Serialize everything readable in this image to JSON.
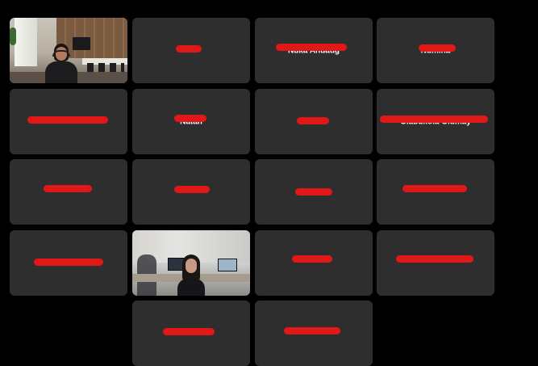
{
  "meeting": {
    "layout": "gallery-view",
    "tile_background": "#2e2e2e",
    "redaction_color": "#e01818"
  },
  "participants": [
    {
      "id": "p1",
      "display_name": "",
      "video_on": true,
      "scene": "office-woman-headset"
    },
    {
      "id": "p2",
      "display_name": "",
      "video_on": false
    },
    {
      "id": "p3",
      "display_name": "Nuka Anuaug",
      "video_on": false
    },
    {
      "id": "p4",
      "display_name": "Numina",
      "video_on": false
    },
    {
      "id": "p5",
      "display_name": "",
      "video_on": false
    },
    {
      "id": "p6",
      "display_name": "Natan",
      "video_on": false
    },
    {
      "id": "p7",
      "display_name": "",
      "video_on": false
    },
    {
      "id": "p8",
      "display_name": "Olabukola Olumay",
      "video_on": false
    },
    {
      "id": "p9",
      "display_name": "",
      "video_on": false
    },
    {
      "id": "p10",
      "display_name": "",
      "video_on": false
    },
    {
      "id": "p11",
      "display_name": "",
      "video_on": false
    },
    {
      "id": "p12",
      "display_name": "",
      "video_on": false
    },
    {
      "id": "p13",
      "display_name": "",
      "video_on": false
    },
    {
      "id": "p14",
      "display_name": "",
      "video_on": true,
      "scene": "office-woman"
    },
    {
      "id": "p15",
      "display_name": "",
      "video_on": false
    },
    {
      "id": "p16",
      "display_name": "",
      "video_on": false
    },
    {
      "id": "p17",
      "display_name": "",
      "video_on": false
    },
    {
      "id": "p18",
      "display_name": "",
      "video_on": false
    }
  ]
}
